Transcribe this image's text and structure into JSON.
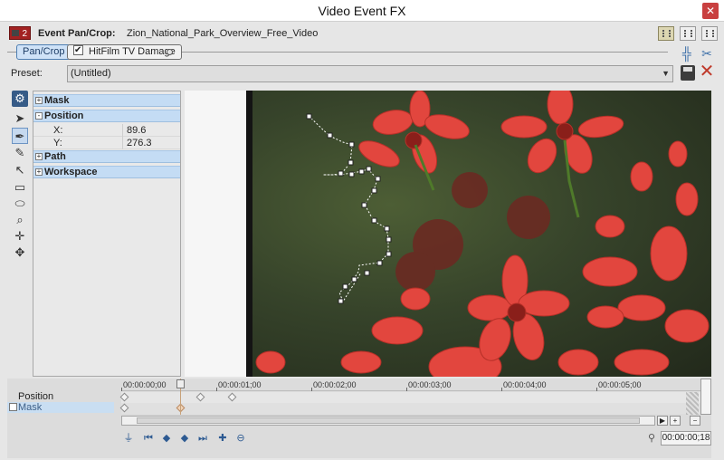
{
  "window": {
    "title": "Video Event FX"
  },
  "header": {
    "fx_badge": "2",
    "event_label": "Event Pan/Crop:",
    "event_name": "Zion_National_Park_Overview_Free_Video"
  },
  "chain": {
    "items": [
      {
        "label": "Pan/Crop"
      },
      {
        "label": "HitFilm TV Damage"
      }
    ]
  },
  "preset": {
    "label": "Preset:",
    "value": "(Untitled)"
  },
  "properties": {
    "categories": [
      {
        "label": "Mask",
        "sign": "+"
      },
      {
        "label": "Position",
        "sign": "-"
      },
      {
        "label": "Path",
        "sign": "+"
      },
      {
        "label": "Workspace",
        "sign": "+"
      }
    ],
    "position": {
      "x_label": "X:",
      "x_value": "89.6",
      "y_label": "Y:",
      "y_value": "276.3"
    }
  },
  "timeline": {
    "ticks": [
      "00:00:00;00",
      "00:00:01;00",
      "00:00:02;00",
      "00:00:03;00",
      "00:00:04;00",
      "00:00:05;00"
    ],
    "tracks": [
      {
        "label": "Position"
      },
      {
        "label": "Mask"
      }
    ],
    "cursor_time": "00:00:00;18"
  },
  "colors": {
    "selection": "#c9def2",
    "accent": "#3b6ea8",
    "flower": "#e2463e"
  }
}
